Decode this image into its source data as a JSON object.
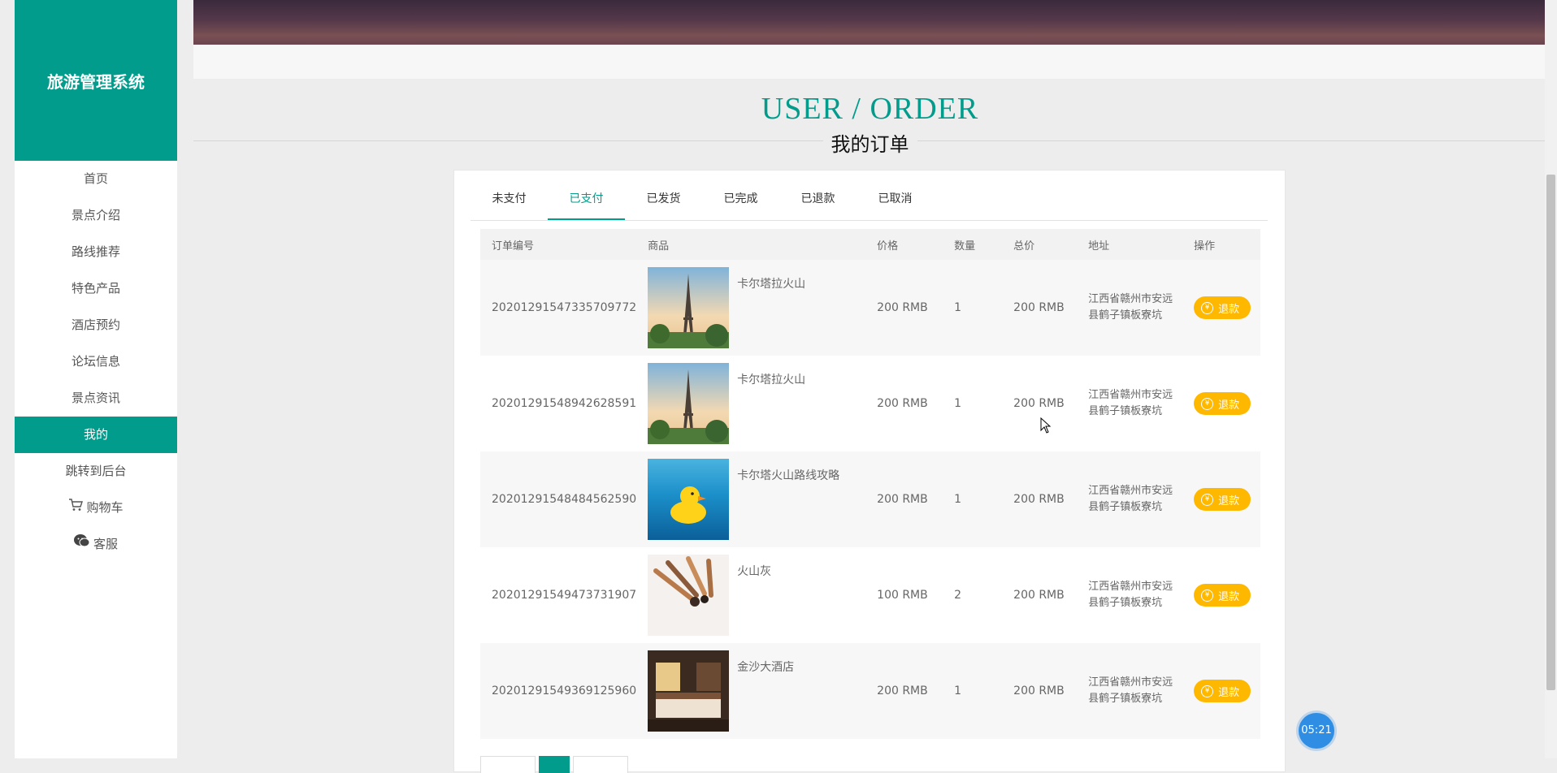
{
  "app": {
    "title": "旅游管理系统"
  },
  "sidebar": {
    "items": [
      {
        "label": "首页"
      },
      {
        "label": "景点介绍"
      },
      {
        "label": "路线推荐"
      },
      {
        "label": "特色产品"
      },
      {
        "label": "酒店预约"
      },
      {
        "label": "论坛信息"
      },
      {
        "label": "景点资讯"
      },
      {
        "label": "我的",
        "active": true
      },
      {
        "label": "跳转到后台"
      },
      {
        "label": "购物车",
        "icon": "cart-icon"
      },
      {
        "label": "客服",
        "icon": "chat-icon"
      }
    ]
  },
  "page": {
    "title_en": "USER / ORDER",
    "title_cn": "我的订单"
  },
  "tabs": [
    {
      "label": "未支付"
    },
    {
      "label": "已支付",
      "active": true
    },
    {
      "label": "已发货"
    },
    {
      "label": "已完成"
    },
    {
      "label": "已退款"
    },
    {
      "label": "已取消"
    }
  ],
  "table": {
    "headers": [
      "订单编号",
      "商品",
      "价格",
      "数量",
      "总价",
      "地址",
      "操作"
    ],
    "rows": [
      {
        "order_no": "20201291547335709772",
        "goods": "卡尔塔拉火山",
        "image": "eiffel-tower-image",
        "price": "200 RMB",
        "qty": "1",
        "total": "200 RMB",
        "address": "江西省赣州市安远县鹤子镇板寮坑",
        "action": "退款"
      },
      {
        "order_no": "20201291548942628591",
        "goods": "卡尔塔拉火山",
        "image": "eiffel-tower-image",
        "price": "200 RMB",
        "qty": "1",
        "total": "200 RMB",
        "address": "江西省赣州市安远县鹤子镇板寮坑",
        "action": "退款"
      },
      {
        "order_no": "20201291548484562590",
        "goods": "卡尔塔火山路线攻略",
        "image": "rubber-duck-image",
        "price": "200 RMB",
        "qty": "1",
        "total": "200 RMB",
        "address": "江西省赣州市安远县鹤子镇板寮坑",
        "action": "退款"
      },
      {
        "order_no": "20201291549473731907",
        "goods": "火山灰",
        "image": "makeup-brushes-image",
        "price": "100 RMB",
        "qty": "2",
        "total": "200 RMB",
        "address": "江西省赣州市安远县鹤子镇板寮坑",
        "action": "退款"
      },
      {
        "order_no": "20201291549369125960",
        "goods": "金沙大酒店",
        "image": "hotel-room-image",
        "price": "200 RMB",
        "qty": "1",
        "total": "200 RMB",
        "address": "江西省赣州市安远县鹤子镇板寮坑",
        "action": "退款"
      }
    ]
  },
  "timer": {
    "text": "05:21"
  },
  "colors": {
    "accent": "#029c8c",
    "refund": "#ffb800",
    "timer": "#2f8de4"
  }
}
